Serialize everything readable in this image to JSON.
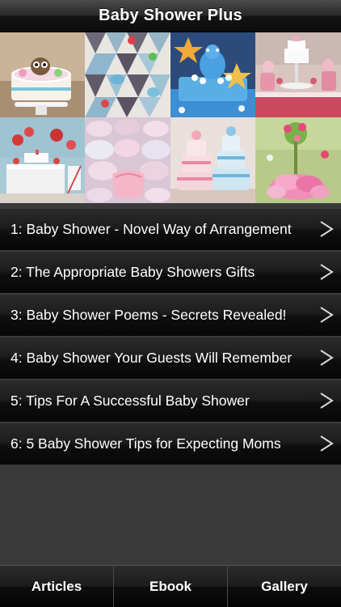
{
  "app": {
    "title": "Baby Shower Plus"
  },
  "collage": {
    "photos": [
      {
        "name": "owl-cake-photo"
      },
      {
        "name": "argyle-cookies-photo"
      },
      {
        "name": "blue-star-cake-photo"
      },
      {
        "name": "pink-dessert-table-photo"
      },
      {
        "name": "party-table-photo"
      },
      {
        "name": "diaper-booties-photo"
      },
      {
        "name": "diaper-cake-photo"
      },
      {
        "name": "flower-centerpiece-photo"
      }
    ]
  },
  "articles": [
    {
      "label": "1: Baby Shower - Novel Way of Arrangement"
    },
    {
      "label": "2: The Appropriate Baby Showers Gifts"
    },
    {
      "label": "3: Baby Shower Poems - Secrets Revealed!"
    },
    {
      "label": "4: Baby Shower Your Guests Will Remember"
    },
    {
      "label": "5: Tips For A Successful Baby Shower"
    },
    {
      "label": "6: 5 Baby Shower Tips for Expecting Moms"
    }
  ],
  "chevron_glyph": ">",
  "tabs": [
    {
      "label": "Articles"
    },
    {
      "label": "Ebook"
    },
    {
      "label": "Gallery"
    }
  ],
  "colors": {
    "background": "#3a3a3a",
    "text": "#ffffff",
    "bar": "#0c0c0c"
  }
}
